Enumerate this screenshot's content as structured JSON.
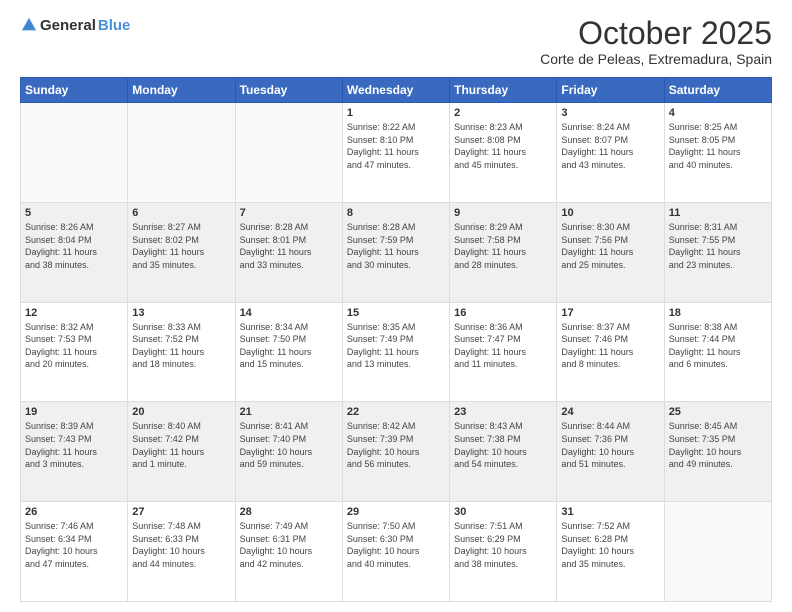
{
  "header": {
    "logo_general": "General",
    "logo_blue": "Blue",
    "month": "October 2025",
    "location": "Corte de Peleas, Extremadura, Spain"
  },
  "weekdays": [
    "Sunday",
    "Monday",
    "Tuesday",
    "Wednesday",
    "Thursday",
    "Friday",
    "Saturday"
  ],
  "days": [
    {
      "num": "",
      "info": ""
    },
    {
      "num": "",
      "info": ""
    },
    {
      "num": "",
      "info": ""
    },
    {
      "num": "1",
      "info": "Sunrise: 8:22 AM\nSunset: 8:10 PM\nDaylight: 11 hours\nand 47 minutes."
    },
    {
      "num": "2",
      "info": "Sunrise: 8:23 AM\nSunset: 8:08 PM\nDaylight: 11 hours\nand 45 minutes."
    },
    {
      "num": "3",
      "info": "Sunrise: 8:24 AM\nSunset: 8:07 PM\nDaylight: 11 hours\nand 43 minutes."
    },
    {
      "num": "4",
      "info": "Sunrise: 8:25 AM\nSunset: 8:05 PM\nDaylight: 11 hours\nand 40 minutes."
    },
    {
      "num": "5",
      "info": "Sunrise: 8:26 AM\nSunset: 8:04 PM\nDaylight: 11 hours\nand 38 minutes."
    },
    {
      "num": "6",
      "info": "Sunrise: 8:27 AM\nSunset: 8:02 PM\nDaylight: 11 hours\nand 35 minutes."
    },
    {
      "num": "7",
      "info": "Sunrise: 8:28 AM\nSunset: 8:01 PM\nDaylight: 11 hours\nand 33 minutes."
    },
    {
      "num": "8",
      "info": "Sunrise: 8:28 AM\nSunset: 7:59 PM\nDaylight: 11 hours\nand 30 minutes."
    },
    {
      "num": "9",
      "info": "Sunrise: 8:29 AM\nSunset: 7:58 PM\nDaylight: 11 hours\nand 28 minutes."
    },
    {
      "num": "10",
      "info": "Sunrise: 8:30 AM\nSunset: 7:56 PM\nDaylight: 11 hours\nand 25 minutes."
    },
    {
      "num": "11",
      "info": "Sunrise: 8:31 AM\nSunset: 7:55 PM\nDaylight: 11 hours\nand 23 minutes."
    },
    {
      "num": "12",
      "info": "Sunrise: 8:32 AM\nSunset: 7:53 PM\nDaylight: 11 hours\nand 20 minutes."
    },
    {
      "num": "13",
      "info": "Sunrise: 8:33 AM\nSunset: 7:52 PM\nDaylight: 11 hours\nand 18 minutes."
    },
    {
      "num": "14",
      "info": "Sunrise: 8:34 AM\nSunset: 7:50 PM\nDaylight: 11 hours\nand 15 minutes."
    },
    {
      "num": "15",
      "info": "Sunrise: 8:35 AM\nSunset: 7:49 PM\nDaylight: 11 hours\nand 13 minutes."
    },
    {
      "num": "16",
      "info": "Sunrise: 8:36 AM\nSunset: 7:47 PM\nDaylight: 11 hours\nand 11 minutes."
    },
    {
      "num": "17",
      "info": "Sunrise: 8:37 AM\nSunset: 7:46 PM\nDaylight: 11 hours\nand 8 minutes."
    },
    {
      "num": "18",
      "info": "Sunrise: 8:38 AM\nSunset: 7:44 PM\nDaylight: 11 hours\nand 6 minutes."
    },
    {
      "num": "19",
      "info": "Sunrise: 8:39 AM\nSunset: 7:43 PM\nDaylight: 11 hours\nand 3 minutes."
    },
    {
      "num": "20",
      "info": "Sunrise: 8:40 AM\nSunset: 7:42 PM\nDaylight: 11 hours\nand 1 minute."
    },
    {
      "num": "21",
      "info": "Sunrise: 8:41 AM\nSunset: 7:40 PM\nDaylight: 10 hours\nand 59 minutes."
    },
    {
      "num": "22",
      "info": "Sunrise: 8:42 AM\nSunset: 7:39 PM\nDaylight: 10 hours\nand 56 minutes."
    },
    {
      "num": "23",
      "info": "Sunrise: 8:43 AM\nSunset: 7:38 PM\nDaylight: 10 hours\nand 54 minutes."
    },
    {
      "num": "24",
      "info": "Sunrise: 8:44 AM\nSunset: 7:36 PM\nDaylight: 10 hours\nand 51 minutes."
    },
    {
      "num": "25",
      "info": "Sunrise: 8:45 AM\nSunset: 7:35 PM\nDaylight: 10 hours\nand 49 minutes."
    },
    {
      "num": "26",
      "info": "Sunrise: 7:46 AM\nSunset: 6:34 PM\nDaylight: 10 hours\nand 47 minutes."
    },
    {
      "num": "27",
      "info": "Sunrise: 7:48 AM\nSunset: 6:33 PM\nDaylight: 10 hours\nand 44 minutes."
    },
    {
      "num": "28",
      "info": "Sunrise: 7:49 AM\nSunset: 6:31 PM\nDaylight: 10 hours\nand 42 minutes."
    },
    {
      "num": "29",
      "info": "Sunrise: 7:50 AM\nSunset: 6:30 PM\nDaylight: 10 hours\nand 40 minutes."
    },
    {
      "num": "30",
      "info": "Sunrise: 7:51 AM\nSunset: 6:29 PM\nDaylight: 10 hours\nand 38 minutes."
    },
    {
      "num": "31",
      "info": "Sunrise: 7:52 AM\nSunset: 6:28 PM\nDaylight: 10 hours\nand 35 minutes."
    },
    {
      "num": "",
      "info": ""
    }
  ]
}
